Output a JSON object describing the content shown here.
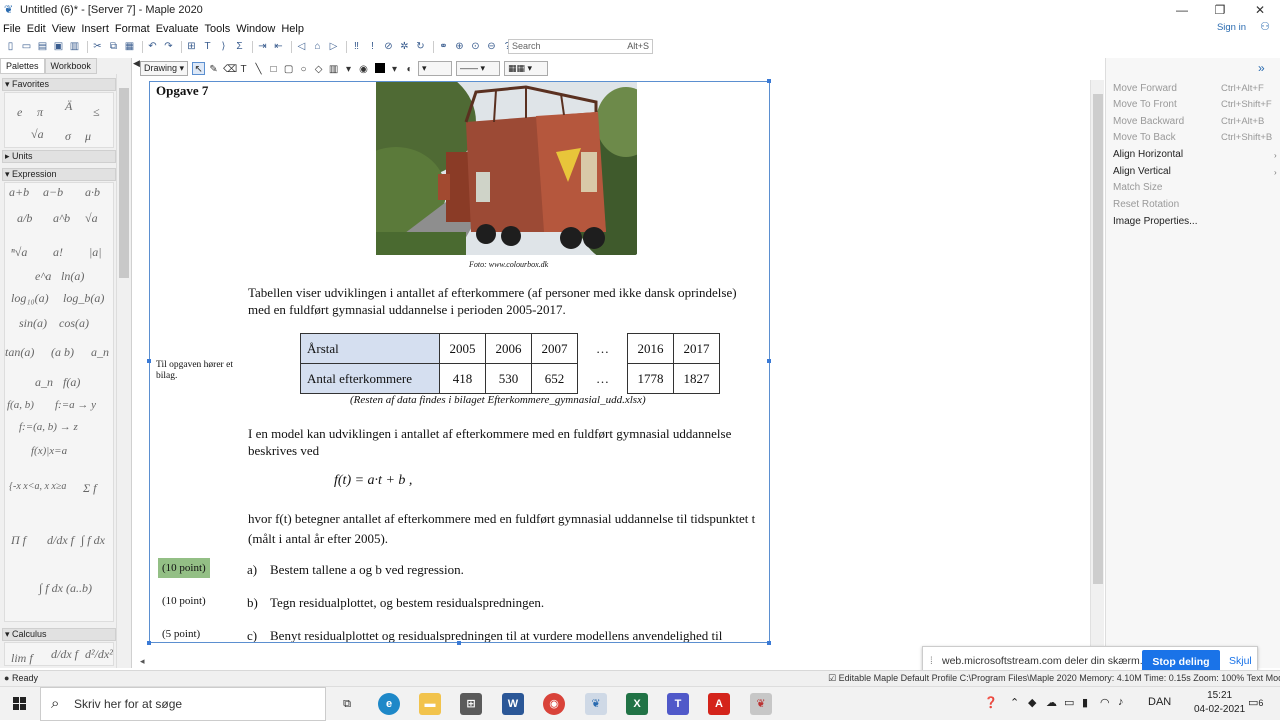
{
  "window": {
    "title": "Untitled (6)* - [Server 7] - Maple 2020",
    "controls": {
      "minimize": "—",
      "restore": "❐",
      "close": "✕"
    }
  },
  "menu": {
    "items": [
      "File",
      "Edit",
      "View",
      "Insert",
      "Format",
      "Evaluate",
      "Tools",
      "Window",
      "Help"
    ],
    "signin": "Sign in"
  },
  "search": {
    "placeholder": "Search",
    "shortcut": "Alt+S"
  },
  "toolbar2": {
    "mode": "Drawing"
  },
  "palettes": {
    "tabs": [
      "Palettes",
      "Workbook"
    ],
    "sections": [
      "Favorites",
      "Units",
      "Expression",
      "Calculus"
    ],
    "favorites": [
      "e",
      "π",
      "Ä",
      "≤",
      "√a",
      "σ",
      "μ"
    ],
    "expression": [
      "a+b",
      "a−b",
      "a·b",
      "a/b",
      "a^b",
      "√a",
      "ⁿ√a",
      "a!",
      "|a|",
      "e^a",
      "ln(a)",
      "log₁₀(a)",
      "log_b(a)",
      "sin(a)",
      "cos(a)",
      "tan(a)",
      "(a b)",
      "a_n",
      "a_n",
      "f(a)",
      "f(a, b)",
      "f:=a → y",
      "f:=(a, b) → z",
      "f(x)|x=a",
      "{-x x<a, x x≥a",
      "Σ f",
      "Π f",
      "d/dx f",
      "∫ f dx",
      "∫ f dx (a..b)"
    ],
    "calculus": [
      "lim f",
      "d/dx f",
      "d²/dx² f"
    ]
  },
  "document": {
    "heading": "Opgave 7",
    "photo_caption": "Foto: www.colourbox.dk",
    "intro": "Tabellen viser udviklingen i antallet af efterkommere (af personer med ikke dansk oprindelse) med en fuldført gymnasial uddannelse i perioden 2005-2017.",
    "sidenote": "Til opgaven hører et bilag.",
    "table": {
      "row1_label": "Årstal",
      "row2_label": "Antal efterkommere",
      "years": [
        "2005",
        "2006",
        "2007",
        "…",
        "2016",
        "2017"
      ],
      "values": [
        "418",
        "530",
        "652",
        "…",
        "1778",
        "1827"
      ]
    },
    "table_note": "(Resten af data findes i bilaget Efterkommere_gymnasial_udd.xlsx)",
    "model_text": "I en model kan udviklingen i antallet af efterkommere med en fuldført gymnasial uddannelse beskrives ved",
    "formula": "f(t) = a·t + b ,",
    "hvor_text": "hvor  f(t)  betegner antallet af efterkommere med en fuldført gymnasial uddannelse til tidspunktet t (målt i antal år efter 2005).",
    "questions": [
      {
        "points": "(10 point)",
        "label": "a)",
        "text": "Bestem tallene a og b ved regression."
      },
      {
        "points": "(10 point)",
        "label": "b)",
        "text": "Tegn residualplottet, og bestem residualspredningen."
      },
      {
        "points": "(5 point)",
        "label": "c)",
        "text": "Benyt residualplottet og residualspredningen til at vurdere modellens anvendelighed til"
      }
    ]
  },
  "context_menu": {
    "items": [
      {
        "label": "Move Forward",
        "shortcut": "Ctrl+Alt+F"
      },
      {
        "label": "Move To Front",
        "shortcut": "Ctrl+Shift+F"
      },
      {
        "label": "Move Backward",
        "shortcut": "Ctrl+Alt+B"
      },
      {
        "label": "Move To Back",
        "shortcut": "Ctrl+Shift+B"
      },
      {
        "label": "Align Horizontal",
        "shortcut": ""
      },
      {
        "label": "Align Vertical",
        "shortcut": ""
      },
      {
        "label": "Match Size",
        "shortcut": ""
      },
      {
        "label": "Reset Rotation",
        "shortcut": ""
      },
      {
        "label": "Image Properties...",
        "shortcut": ""
      }
    ]
  },
  "share_notice": {
    "message": "web.microsoftstream.com deler din skærm.",
    "stop": "Stop deling",
    "hide": "Skjul"
  },
  "status": {
    "ready": "Ready",
    "right": "Editable   Maple Default Profile   C:\\Program Files\\Maple 2020   Memory: 4.10M   Time: 0.15s   Zoom: 100%   Text Mode"
  },
  "taskbar": {
    "search_placeholder": "Skriv her for at søge",
    "language": "DAN",
    "time": "15:21",
    "date": "04-02-2021",
    "notifications": "6"
  },
  "colors": {
    "accent": "#1a73e8",
    "points_highlight": "#93bf85",
    "table_header": "#d5dff0",
    "selection": "#5b8fd0"
  }
}
